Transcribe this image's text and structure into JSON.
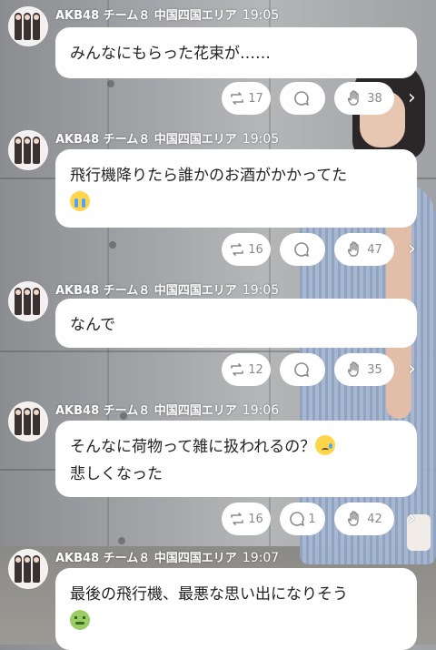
{
  "posts": [
    {
      "group": "AKB48 チーム８ 中国四国エリア",
      "time": "19:05",
      "lines": [
        "みんなにもらった花束が……"
      ],
      "emoji": "",
      "reposts": "17",
      "comments": "",
      "claps": "38"
    },
    {
      "group": "AKB48 チーム８ 中国四国エリア",
      "time": "19:05",
      "lines": [
        "飛行機降りたら誰かのお酒がかかってた"
      ],
      "emoji": "crying-face-icon",
      "reposts": "16",
      "comments": "",
      "claps": "47"
    },
    {
      "group": "AKB48 チーム８ 中国四国エリア",
      "time": "19:05",
      "lines": [
        "なんで"
      ],
      "emoji": "",
      "reposts": "12",
      "comments": "",
      "claps": "35"
    },
    {
      "group": "AKB48 チーム８ 中国四国エリア",
      "time": "19:06",
      "lines": [
        "そんなに荷物って雑に扱われるの？",
        "悲しくなった"
      ],
      "emoji": "sad-tear-face-icon",
      "reposts": "16",
      "comments": "1",
      "claps": "42"
    },
    {
      "group": "AKB48 チーム８ 中国四国エリア",
      "time": "19:07",
      "lines": [
        "最後の飛行機、最悪な思い出になりそう"
      ],
      "emoji": "nauseated-face-icon",
      "reposts": "",
      "comments": "",
      "claps": ""
    }
  ],
  "icons": {
    "repost": "repost-icon",
    "comment": "comment-icon",
    "clap": "clap-icon",
    "more": "chevron-right-icon"
  },
  "colors": {
    "bubble": "#ffffff",
    "text": "#222222",
    "count": "#8a8a8a"
  }
}
